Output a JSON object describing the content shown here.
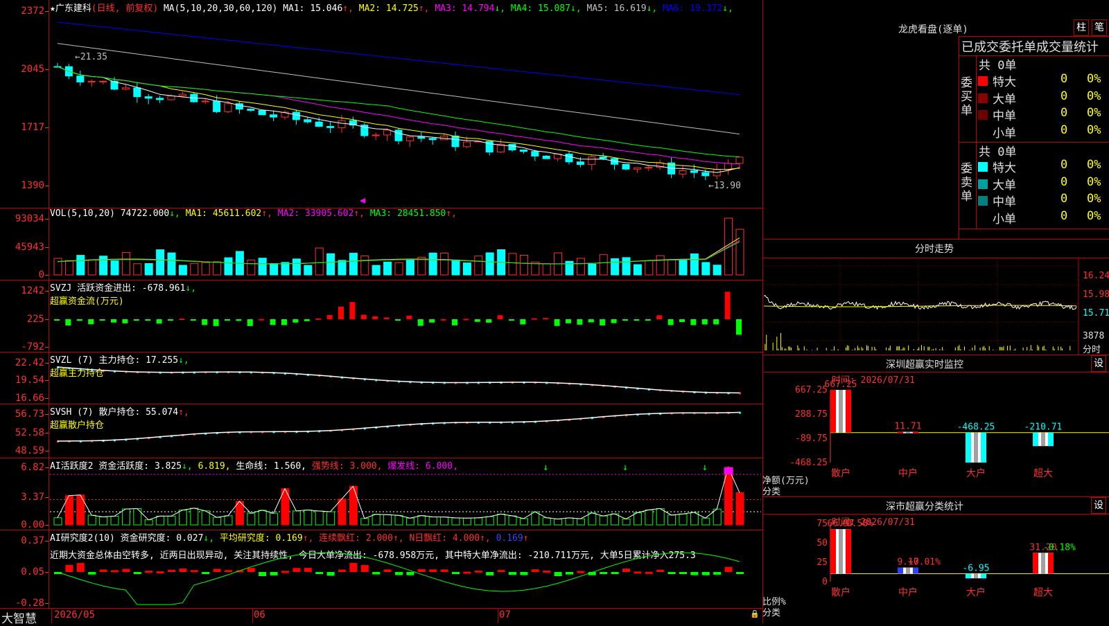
{
  "main": {
    "star": "★",
    "stock_name": "广东建科",
    "period": "(日线, 前复权)",
    "ma_params": "MA(5,10,20,30,60,120)",
    "ma": [
      {
        "name": "MA1:",
        "value": "15.046",
        "arrow": "↑",
        "color": "#ffffff"
      },
      {
        "name": "MA2:",
        "value": "14.725",
        "arrow": "↑",
        "color": "#ffff00"
      },
      {
        "name": "MA3:",
        "value": "14.794",
        "arrow": "↓",
        "color": "#ff00ff"
      },
      {
        "name": "MA4:",
        "value": "15.087",
        "arrow": "↓",
        "color": "#00ff00"
      },
      {
        "name": "MA5:",
        "value": "16.619",
        "arrow": "↓",
        "color": "#c0c0c0"
      },
      {
        "name": "MA6:",
        "value": "19.372",
        "arrow": "↓",
        "color": "#0000ff"
      }
    ],
    "yticks": [
      "2372",
      "2045",
      "1717",
      "1390"
    ],
    "high_mark": "←21.35",
    "low_mark": "←13.90"
  },
  "vol": {
    "header": "VOL(5,10,20)",
    "value": "74722.000",
    "arrow": "↓",
    "ma": [
      {
        "name": "MA1:",
        "value": "45611.602",
        "arrow": "↑",
        "color": "#ffff00"
      },
      {
        "name": "MA2:",
        "value": "33905.602",
        "arrow": "↑",
        "color": "#ff00ff"
      },
      {
        "name": "MA3:",
        "value": "28451.850",
        "arrow": "↑",
        "color": "#00ff00"
      }
    ],
    "yticks": [
      "93034",
      "45943",
      "0"
    ]
  },
  "svzj": {
    "header": "SVZJ  活跃资金进出: -678.961",
    "arrow": "↓,",
    "sub": "超赢资金流(万元)",
    "yticks": [
      "1242",
      "225",
      "-792"
    ]
  },
  "svzl": {
    "header": "SVZL (7) 主力持仓: 17.255",
    "arrow": "↓,",
    "sub": "超赢主力持仓",
    "yticks": [
      "22.42",
      "19.54",
      "16.66"
    ]
  },
  "svsh": {
    "header": "SVSH (7) 散户持仓: 55.074",
    "arrow": "↑,",
    "sub": "超赢散户持仓",
    "yticks": [
      "56.73",
      "52.58",
      "48.59"
    ]
  },
  "ai1": {
    "header": "AI活跃度2 资金活跃度: 3.825",
    "v2": "6.819,",
    "v2_arrow": "↓,",
    "v1_arrow": "↓,",
    "life": "生命线: 1.560,",
    "strong": "强势线: 3.000,",
    "burst": "爆发线: 6.000,",
    "yticks": [
      "6.82",
      "3.37",
      "0.00"
    ]
  },
  "ai2": {
    "header": "AI研究度2(10) 资金研究度: 0.027",
    "arrow": "↓,",
    "avg": "平均研究度: 0.169",
    "avg_arrow": "↑,",
    "cont": "连续飘红: 2.000",
    "cont_arrow": "↑,",
    "nday": "N日飘红: 4.000",
    "nday_arrow": "↑,",
    "last": "0.169",
    "last_arrow": "↑",
    "comment": "近期大资金总体由空转多, 近两日出现异动, 关注其持续性, 今日大单净流出: -678.958万元, 其中特大单净流出: -210.711万元, 大单5日累计净入275.3",
    "yticks": [
      "0.37",
      "0.05",
      "-0.28"
    ]
  },
  "xaxis": {
    "brand": "大智慧",
    "labels": [
      "2026/05",
      "06",
      "07"
    ]
  },
  "right": {
    "lhb_title": "龙虎看盘(逐单)",
    "btn_zhu": "柱",
    "btn_bi": "笔",
    "stat_title": "已成交委托单成交量统计",
    "buy": {
      "side": "委买单",
      "total": "共 0单",
      "rows": [
        {
          "label": "特大",
          "count": "0",
          "pct": "0%",
          "color": "#ff0000"
        },
        {
          "label": "大单",
          "count": "0",
          "pct": "0%",
          "color": "#8b0000"
        },
        {
          "label": "中单",
          "count": "0",
          "pct": "0%",
          "color": "#700000"
        },
        {
          "label": "小单",
          "count": "0",
          "pct": "0%",
          "color": "#000000"
        }
      ]
    },
    "sell": {
      "side": "委卖单",
      "total": "共 0单",
      "rows": [
        {
          "label": "特大",
          "count": "0",
          "pct": "0%",
          "color": "#00ffff"
        },
        {
          "label": "大单",
          "count": "0",
          "pct": "0%",
          "color": "#00a0a0"
        },
        {
          "label": "中单",
          "count": "0",
          "pct": "0%",
          "color": "#008080"
        },
        {
          "label": "小单",
          "count": "0",
          "pct": "0%",
          "color": "#000000"
        }
      ]
    },
    "intraday": {
      "title": "分时走势",
      "prices": [
        "16.24",
        "15.98",
        "15.71"
      ],
      "vol": "3878",
      "vol_unit": "分时"
    },
    "monitor": {
      "title": "深圳超赢实时监控",
      "btn": "设",
      "time": "时间: 2026/07/31",
      "yticks": [
        "667.25",
        "288.75",
        "-89.75",
        "-468.25"
      ],
      "unit": "净额(万元)",
      "unit2": "分类",
      "bars": [
        {
          "cat": "散户",
          "value": 667.25,
          "label": "667.25"
        },
        {
          "cat": "中户",
          "value": 11.71,
          "label": "11.71"
        },
        {
          "cat": "大户",
          "value": -468.25,
          "label": "-468.25"
        },
        {
          "cat": "超大",
          "value": -210.71,
          "label": "-210.71"
        }
      ]
    },
    "classify": {
      "title": "深市超赢分类统计",
      "btn": "设",
      "time": "时间: 2026/07/31",
      "yticks": [
        "75",
        "50",
        "25",
        "0"
      ],
      "unit": "比例%",
      "unit2": "分类",
      "bars": [
        {
          "cat": "散户",
          "value": 66.57,
          "label": "66.57",
          "chg": "+0.58%"
        },
        {
          "cat": "中户",
          "value": 9.17,
          "label": "9.17",
          "chg": "+0.01%"
        },
        {
          "cat": "大户",
          "value": -6.95,
          "label": "-6.95",
          "chg": ""
        },
        {
          "cat": "超大",
          "value": 31.2,
          "label": "31.20",
          "chg": "-0.18%"
        }
      ]
    }
  },
  "chart_data": {
    "type": "bar",
    "categories": [
      "散户",
      "中户",
      "大户",
      "超大"
    ],
    "series": [
      {
        "name": "净额(万元)",
        "values": [
          667.25,
          11.71,
          -468.25,
          -210.71
        ]
      },
      {
        "name": "比例%",
        "values": [
          66.57,
          9.17,
          -6.95,
          31.2
        ]
      }
    ],
    "ylim": [
      -468.25,
      667.25
    ]
  }
}
